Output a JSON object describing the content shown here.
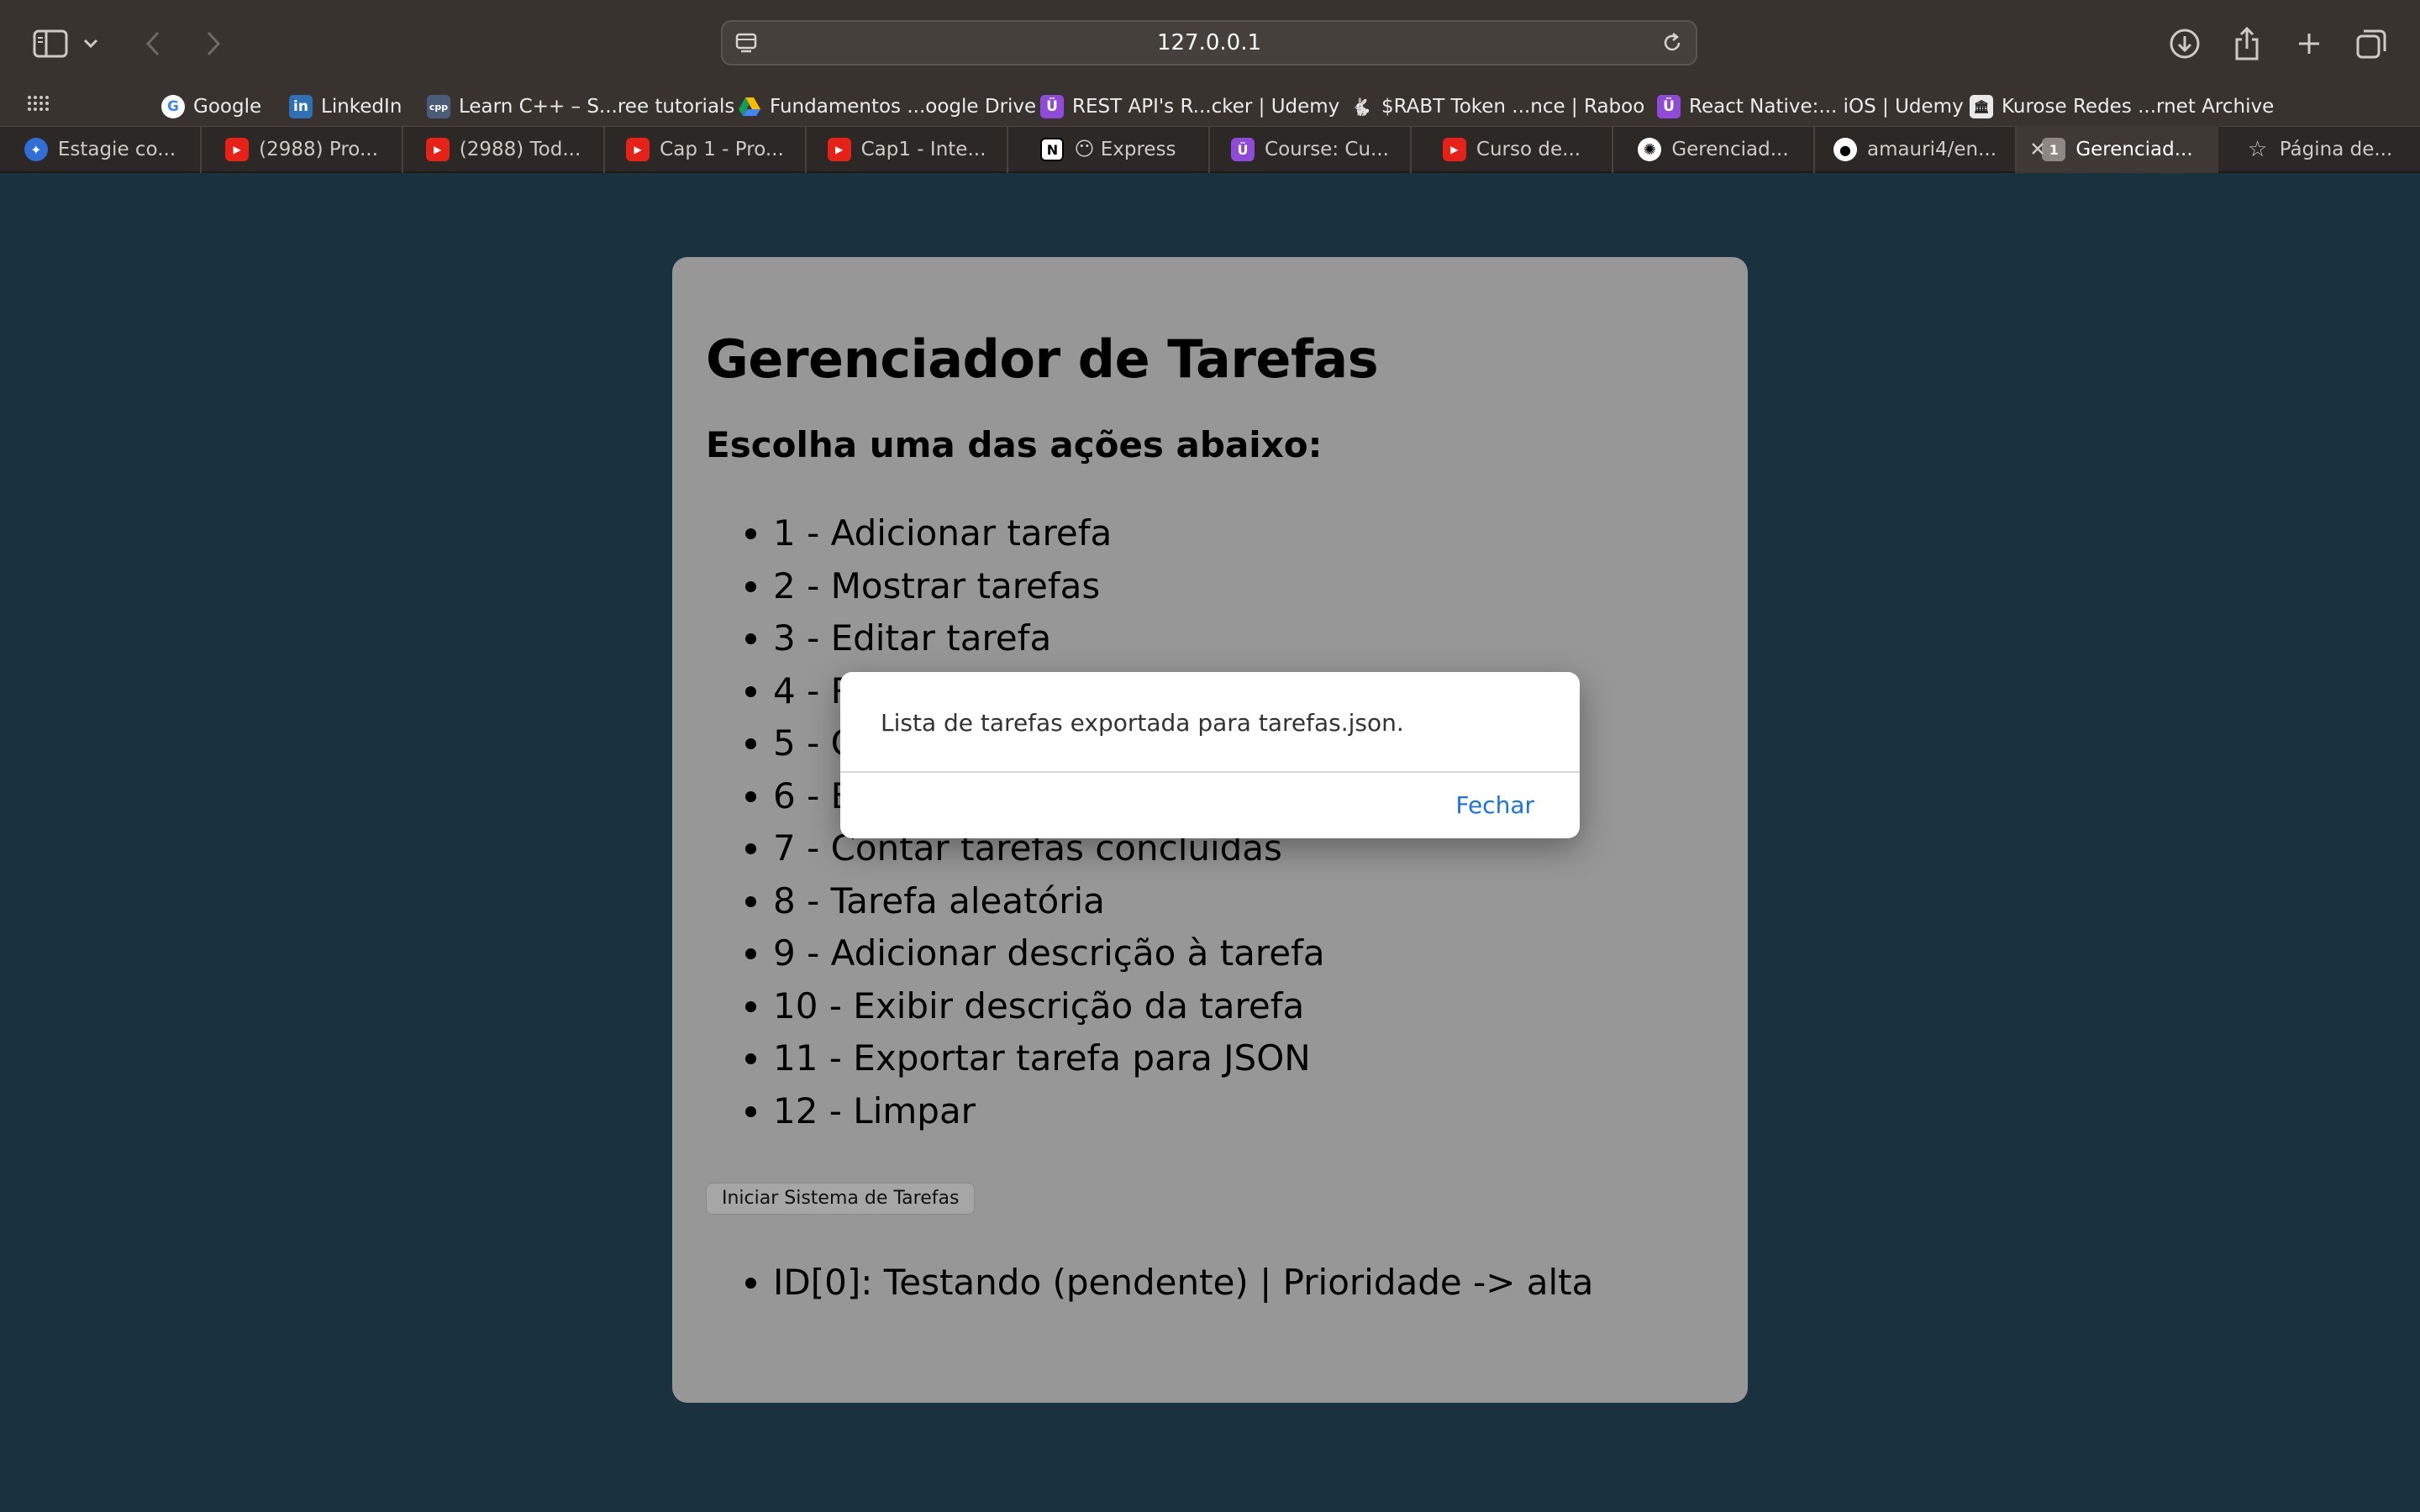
{
  "browser": {
    "url": "127.0.0.1",
    "bookmarks": [
      {
        "label": "Google",
        "icon": "google-icon"
      },
      {
        "label": "LinkedIn",
        "icon": "linkedin-icon"
      },
      {
        "label": "Learn C++ – S...ree tutorials",
        "icon": "cpp-icon"
      },
      {
        "label": "Fundamentos ...oogle Drive",
        "icon": "google-drive-icon"
      },
      {
        "label": "REST API's R...cker | Udemy",
        "icon": "udemy-icon"
      },
      {
        "label": "$RABT Token ...nce | Raboo",
        "icon": "raboo-icon"
      },
      {
        "label": "React Native:... iOS | Udemy",
        "icon": "udemy-icon"
      },
      {
        "label": "Kurose Redes ...rnet Archive",
        "icon": "archive-icon"
      }
    ],
    "tabs": [
      {
        "label": "Estagie co...",
        "icon": "estagie-icon"
      },
      {
        "label": "(2988) Pro...",
        "icon": "youtube-icon"
      },
      {
        "label": "(2988) Tod...",
        "icon": "youtube-icon"
      },
      {
        "label": "Cap 1 - Pro...",
        "icon": "youtube-icon"
      },
      {
        "label": "Cap1 - Inte...",
        "icon": "youtube-icon"
      },
      {
        "label": "😶 Express",
        "icon": "notion-icon"
      },
      {
        "label": "Course: Cu...",
        "icon": "udemy-icon"
      },
      {
        "label": "Curso de...",
        "icon": "youtube-icon"
      },
      {
        "label": "Gerenciad...",
        "icon": "openai-icon"
      },
      {
        "label": "amauri4/en...",
        "icon": "github-icon"
      },
      {
        "label": "Gerenciad...",
        "icon": "page-number-icon",
        "badge": "1",
        "active": true
      },
      {
        "label": "Página de...",
        "icon": "star-icon"
      }
    ]
  },
  "page": {
    "title": "Gerenciador de Tarefas",
    "subtitle": "Escolha uma das ações abaixo:",
    "menu_items": [
      "1 - Adicionar tarefa",
      "2 - Mostrar tarefas",
      "3 - Editar tarefa",
      "4 - R",
      "5 - C",
      "6 - B",
      "7 - Contar tarefas concluídas",
      "8 - Tarefa aleatória",
      "9 - Adicionar descrição à tarefa",
      "10 - Exibir descrição da tarefa",
      "11 - Exportar tarefa para JSON",
      "12 - Limpar"
    ],
    "start_button": "Iniciar Sistema de Tarefas",
    "results": [
      "ID[0]: Testando (pendente) | Prioridade -> alta"
    ]
  },
  "dialog": {
    "message": "Lista de tarefas exportada para tarefas.json.",
    "close_label": "Fechar"
  },
  "colors": {
    "page_background": "#1a313e",
    "card_background": "#979797",
    "dialog_accent": "#1a73e8",
    "toolbar": "#38332f"
  }
}
